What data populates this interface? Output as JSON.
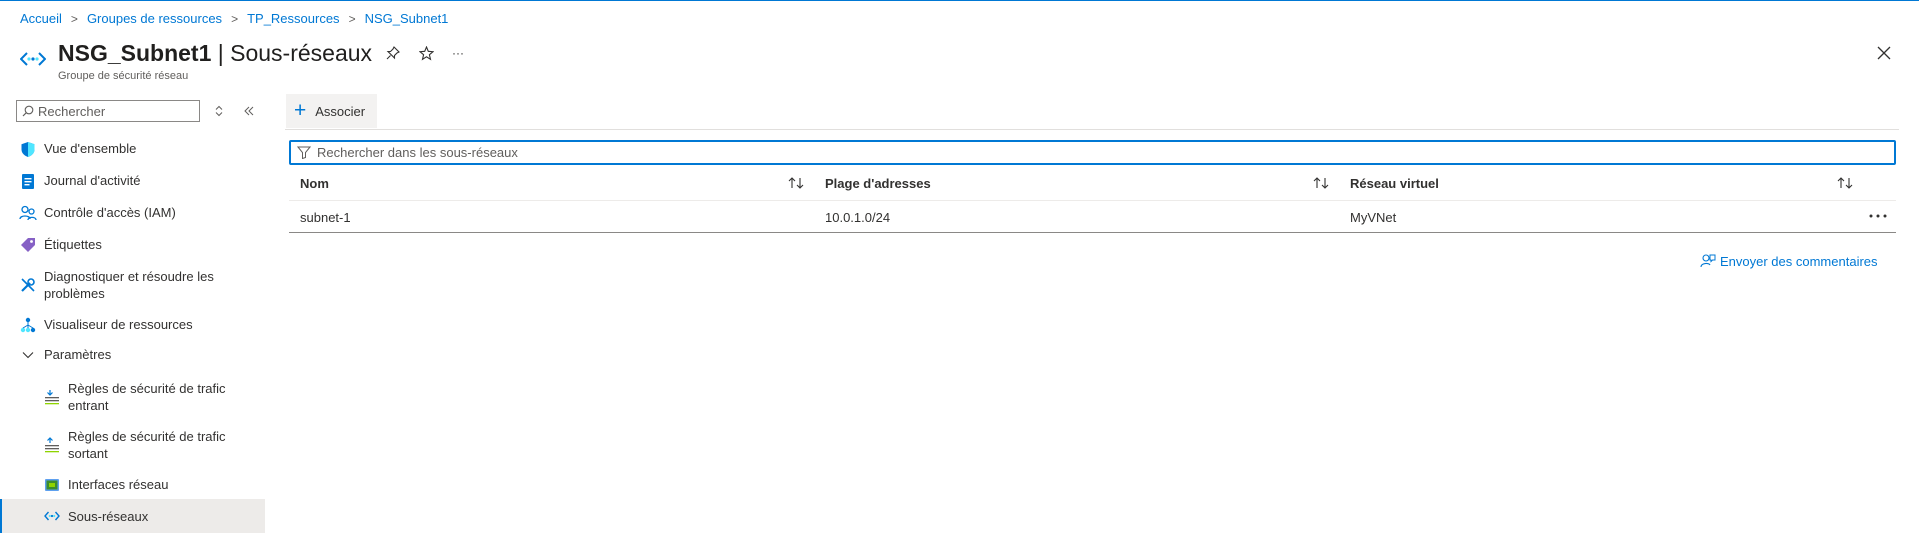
{
  "breadcrumb": [
    "Accueil",
    "Groupes de ressources",
    "TP_Ressources",
    "NSG_Subnet1"
  ],
  "header": {
    "resource_name": "NSG_Subnet1",
    "section_title": "| Sous-réseaux",
    "subtitle": "Groupe de sécurité réseau",
    "pin_icon": "pin-icon",
    "favorite_icon": "star-icon",
    "more_label": "···"
  },
  "sidebar": {
    "search_placeholder": "Rechercher",
    "items": [
      {
        "label": "Vue d'ensemble",
        "icon": "shield-icon"
      },
      {
        "label": "Journal d'activité",
        "icon": "activity-log-icon"
      },
      {
        "label": "Contrôle d'accès (IAM)",
        "icon": "people-icon"
      },
      {
        "label": "Étiquettes",
        "icon": "tag-icon"
      },
      {
        "label": "Diagnostiquer et résoudre les problèmes",
        "icon": "wrench-icon"
      },
      {
        "label": "Visualiseur de ressources",
        "icon": "hierarchy-icon"
      },
      {
        "label": "Paramètres",
        "icon": "chevron-down-icon"
      },
      {
        "label": "Règles de sécurité de trafic entrant",
        "icon": "inbound-rules-icon"
      },
      {
        "label": "Règles de sécurité de trafic sortant",
        "icon": "outbound-rules-icon"
      },
      {
        "label": "Interfaces réseau",
        "icon": "network-interface-icon"
      },
      {
        "label": "Sous-réseaux",
        "icon": "subnet-icon"
      }
    ]
  },
  "toolbar": {
    "associate_label": "Associer"
  },
  "filter": {
    "placeholder": "Rechercher dans les sous-réseaux"
  },
  "table": {
    "columns": [
      "Nom",
      "Plage d'adresses",
      "Réseau virtuel"
    ],
    "rows": [
      {
        "name": "subnet-1",
        "address_range": "10.0.1.0/24",
        "vnet": "MyVNet"
      }
    ]
  },
  "feedback_label": "Envoyer des commentaires",
  "colors": {
    "accent": "#0078d4",
    "active_bg": "#edebe9"
  }
}
